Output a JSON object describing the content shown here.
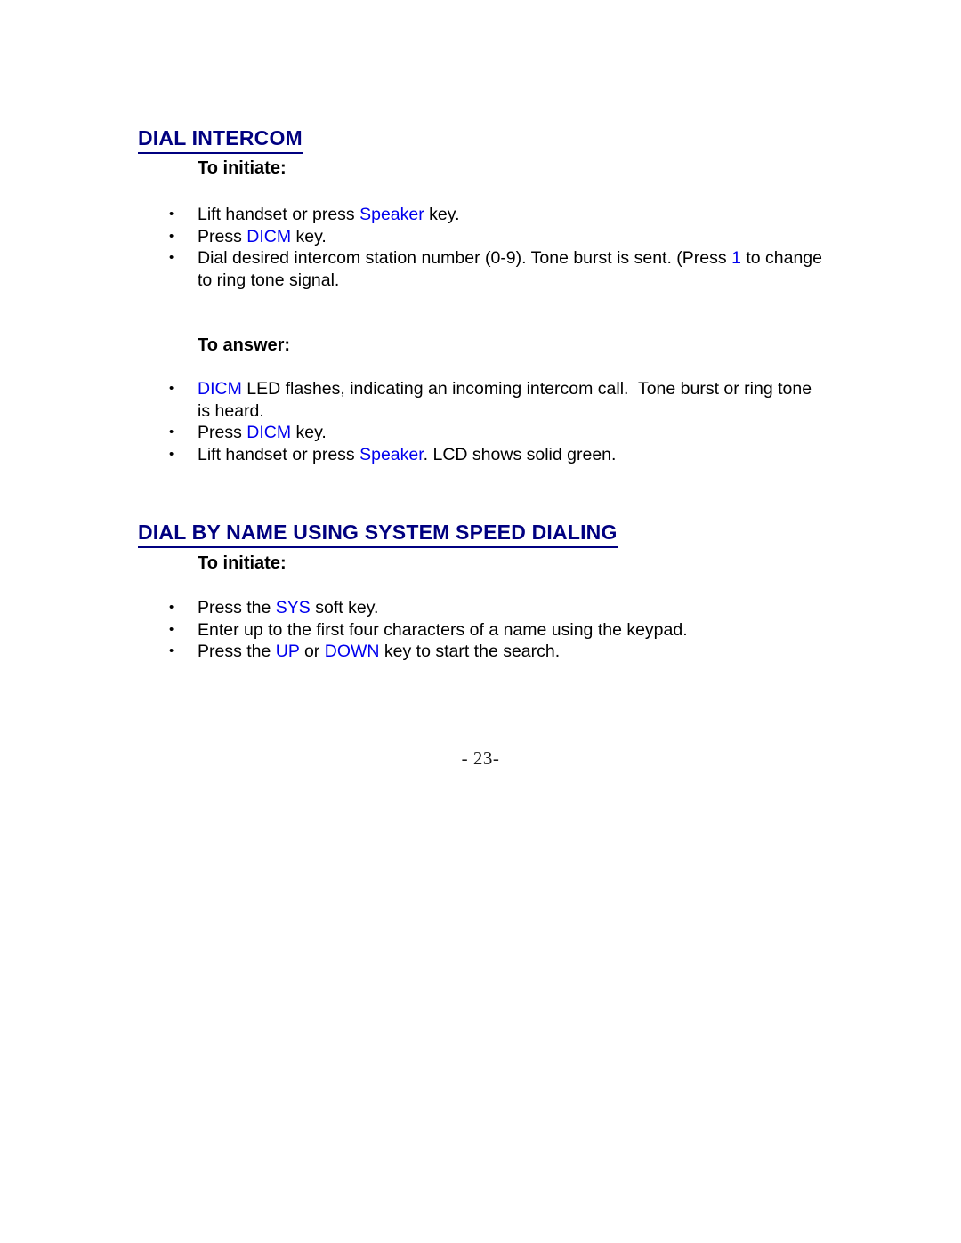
{
  "document": {
    "page_number_label": "- 23-"
  },
  "sections": [
    {
      "heading": "DIAL INTERCOM",
      "groups": [
        {
          "sub_heading": "To initiate:",
          "bullets": [
            [
              {
                "t": "Lift handset or press ",
                "c": "plain"
              },
              {
                "t": "Speaker",
                "c": "key"
              },
              {
                "t": " key.",
                "c": "plain"
              }
            ],
            [
              {
                "t": "Press ",
                "c": "plain"
              },
              {
                "t": "DICM",
                "c": "key"
              },
              {
                "t": " key.",
                "c": "plain"
              }
            ],
            [
              {
                "t": "Dial desired intercom station number (0-9). Tone burst is sent. (Press ",
                "c": "plain"
              },
              {
                "t": "1",
                "c": "key"
              },
              {
                "t": " to change to ring tone signal.",
                "c": "plain"
              }
            ]
          ]
        },
        {
          "sub_heading": "To answer:",
          "bullets": [
            [
              {
                "t": "DICM",
                "c": "key"
              },
              {
                "t": " LED flashes, indicating an incoming intercom call.  Tone burst or ring tone is heard.",
                "c": "plain"
              }
            ],
            [
              {
                "t": "Press ",
                "c": "plain"
              },
              {
                "t": "DICM",
                "c": "key"
              },
              {
                "t": " key.",
                "c": "plain"
              }
            ],
            [
              {
                "t": "Lift handset or press ",
                "c": "plain"
              },
              {
                "t": "Speaker",
                "c": "key"
              },
              {
                "t": ". LCD shows solid green.",
                "c": "plain"
              }
            ]
          ]
        }
      ]
    },
    {
      "heading": "DIAL BY NAME USING SYSTEM SPEED DIALING",
      "groups": [
        {
          "sub_heading": "To initiate:",
          "bullets": [
            [
              {
                "t": "Press the ",
                "c": "plain"
              },
              {
                "t": "SYS",
                "c": "key"
              },
              {
                "t": " soft key.",
                "c": "plain"
              }
            ],
            [
              {
                "t": "Enter up to the first four characters of a name using the keypad.",
                "c": "plain"
              }
            ],
            [
              {
                "t": "Press the ",
                "c": "plain"
              },
              {
                "t": "UP",
                "c": "key"
              },
              {
                "t": " or ",
                "c": "plain"
              },
              {
                "t": "DOWN",
                "c": "key"
              },
              {
                "t": " key to start the search.",
                "c": "plain"
              }
            ]
          ]
        }
      ]
    }
  ],
  "bullet_glyph": "•",
  "colors": {
    "heading": "#000080",
    "keyword": "#0000ee",
    "body": "#000000",
    "background": "#ffffff"
  }
}
